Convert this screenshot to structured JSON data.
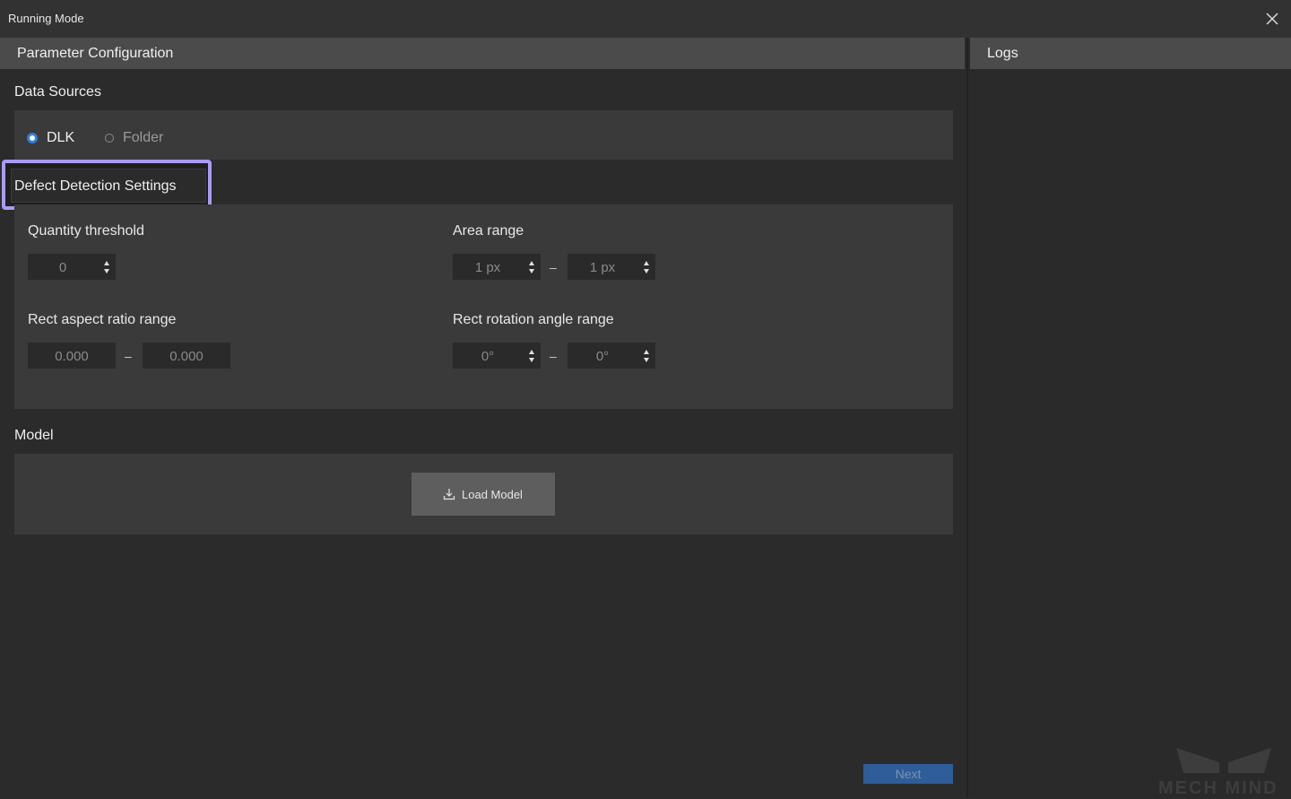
{
  "window": {
    "title": "Running Mode"
  },
  "panels": {
    "left_title": "Parameter Configuration",
    "right_title": "Logs"
  },
  "data_sources": {
    "title": "Data Sources",
    "options": [
      {
        "label": "DLK",
        "selected": true
      },
      {
        "label": "Folder",
        "selected": false
      }
    ]
  },
  "defect_settings": {
    "title": "Defect Detection Settings",
    "quantity_threshold": {
      "label": "Quantity threshold",
      "value": "0"
    },
    "area_range": {
      "label": "Area range",
      "min": "1 px",
      "max": "1 px",
      "separator": "–"
    },
    "aspect_ratio": {
      "label": "Rect aspect ratio range",
      "min": "0.000",
      "max": "0.000",
      "separator": "–"
    },
    "rotation_angle": {
      "label": "Rect rotation angle range",
      "min": "0°",
      "max": "0°",
      "separator": "–"
    }
  },
  "model": {
    "title": "Model",
    "load_button": "Load Model"
  },
  "footer": {
    "next_button": "Next"
  },
  "watermark": {
    "text": "MECH MIND"
  },
  "colors": {
    "accent_blue": "#2f7fdc",
    "highlight": "#a89cf5",
    "next_bg": "#2e5d99"
  }
}
